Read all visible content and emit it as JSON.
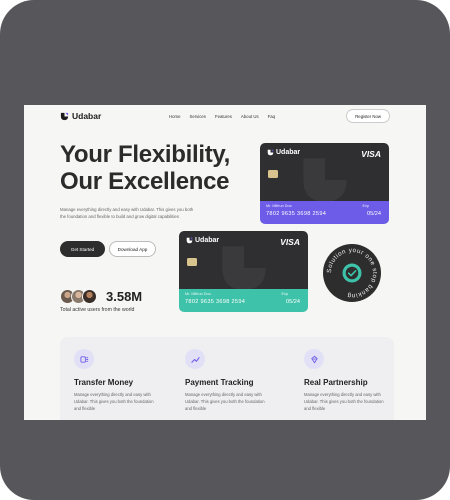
{
  "nav": {
    "brand": "Udabar",
    "links": [
      "Home",
      "Services",
      "Features",
      "About Us",
      "Faq"
    ],
    "register": "Register Now"
  },
  "hero": {
    "headline_1": "Your Flexibility,",
    "headline_2": "Our Excellence",
    "description": "Manage everything directly and easy with Udabar. This gives you both the foundation and flexible to build and grow digital capabilities",
    "primary_button": "Get Started",
    "secondary_button": "Download App",
    "users_count": "3.58M",
    "users_label": "Total active users from the world"
  },
  "cards": [
    {
      "brand": "Udabar",
      "network": "VISA",
      "holder": "Mr. Milfrun Doo",
      "number": "7802  9635  3698  2594",
      "exp_label": "Exp",
      "exp": "05/24",
      "color": "#6c5ce7"
    },
    {
      "brand": "Udabar",
      "network": "VISA",
      "holder": "Mr. Milfrun Doo",
      "number": "7802  9635  3698  2594",
      "exp_label": "Exp",
      "exp": "05/24",
      "color": "#3ec2a9"
    }
  ],
  "badge": {
    "text": "Solution your one stop banking"
  },
  "features": [
    {
      "icon": "transfer-icon",
      "title": "Transfer Money",
      "desc": "Manage everything directly and easy with Udabar. This gives you both the foundation and flexible"
    },
    {
      "icon": "trend-icon",
      "title": "Payment Tracking",
      "desc": "Manage everything directly and easy with Udabar. This gives you both the foundation and flexible"
    },
    {
      "icon": "handshake-icon",
      "title": "Real Partnership",
      "desc": "Manage everything directly and easy with Udabar. This gives you both the foundation and flexible"
    }
  ],
  "colors": {
    "accent": "#6c5ce7",
    "teal": "#3ec2a9",
    "dark": "#2d2d2d",
    "frame": "#56565b"
  }
}
